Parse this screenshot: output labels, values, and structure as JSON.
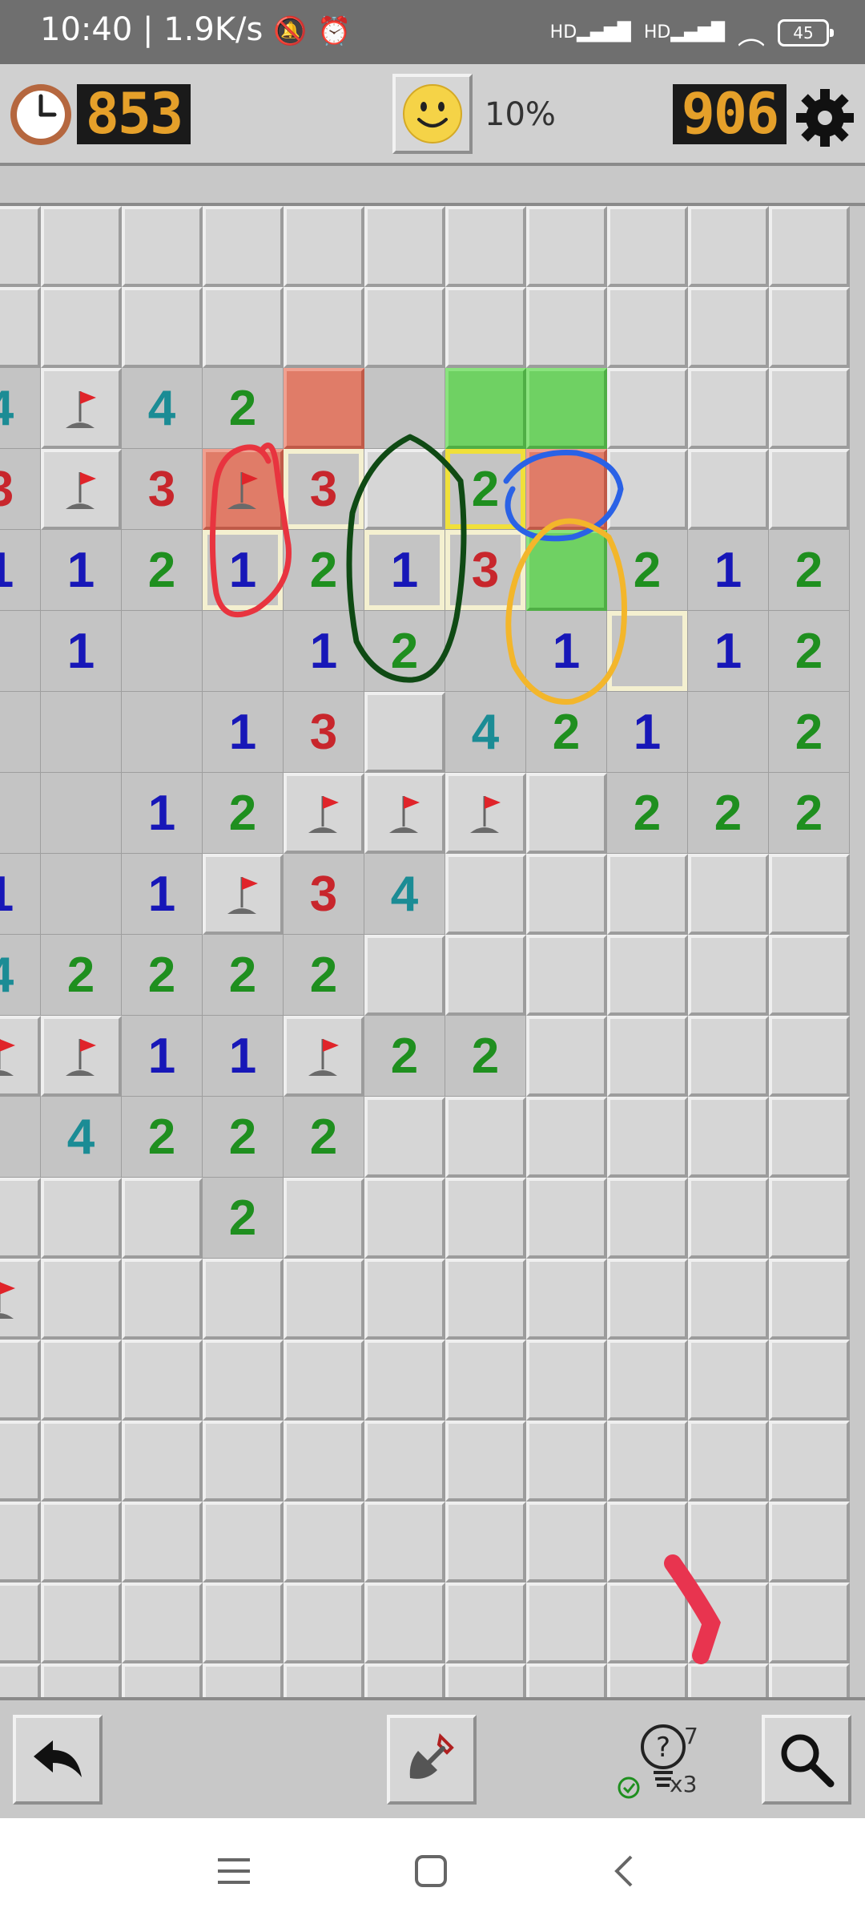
{
  "status_bar": {
    "time": "10:40",
    "speed": "1.9K/s",
    "net1": "HD",
    "net2": "HD",
    "battery": "45"
  },
  "header": {
    "timer_value": "853",
    "progress": "10%",
    "mines_value": "906"
  },
  "hint": {
    "count": "7",
    "multiplier": "x3"
  },
  "colors": {
    "counter_digits": "#e5a02a",
    "green_highlight": "#6fd163",
    "red_highlight": "#e07c68"
  },
  "board": {
    "rows": [
      "CCCCCCCCCCC",
      "CCCCCCCCCCC",
      "4F42rOggCCC",
      "3F3R3C2rCCC",
      "1121213g212",
      "O1OO12O1O12",
      "OOO13C421O2",
      "OO12FFFC222",
      "1O1F34CCCCC",
      "42222CCCCCC",
      "FF11F22CCCC",
      "O4222CCCCCC",
      "CCC2CCCCCCC",
      "FCCCCCCCCCC",
      "CCCCCCCCCCC",
      "CCCCCCCCCCC",
      "CCCCCCCCCCC",
      "CCCCCCCCCCC",
      "CCCCCCCCCCC"
    ]
  }
}
